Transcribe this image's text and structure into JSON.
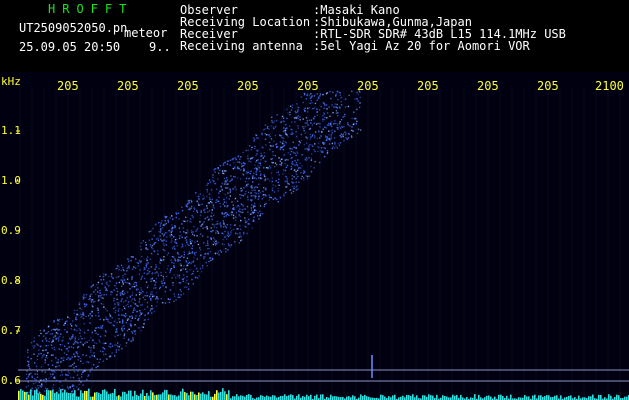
{
  "header": {
    "brand": "HROFFT",
    "filename": "UT2509052050.pn",
    "filename_suffix": "meteor",
    "datetime": "25.09.05 20:50    9..",
    "info": [
      {
        "label": "Observer",
        "value": ":Masaki Kano"
      },
      {
        "label": "Receiving Location",
        "value": ":Shibukawa,Gunma,Japan"
      },
      {
        "label": "Receiver",
        "value": ":RTL-SDR SDR# 43dB L15 114.1MHz USB"
      },
      {
        "label": "Receiving antenna",
        "value": ":5el Yagi Az 20 for Aomori VOR"
      }
    ]
  },
  "spectrogram": {
    "y_unit": "kHz",
    "y_ticks": [
      "1.1",
      "1.0",
      "0.9",
      "0.8",
      "0.7",
      "0.6"
    ],
    "x_ticks": [
      "205",
      "205",
      "205",
      "205",
      "205",
      "205",
      "205",
      "205",
      "205",
      "2100"
    ],
    "colors": {
      "background": "#000010",
      "signal": "#3d6bff",
      "grid": "#1e2a4a",
      "text": "#ffff33",
      "power": "#2fe0e0"
    }
  }
}
